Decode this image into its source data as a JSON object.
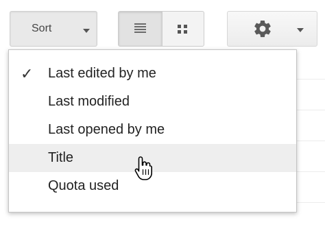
{
  "toolbar": {
    "sort_label": "Sort",
    "sort_caret_icon": "chevron-down-icon",
    "list_view_icon": "list-view-icon",
    "grid_view_icon": "grid-view-icon",
    "settings_icon": "gear-icon",
    "settings_caret_icon": "chevron-down-icon"
  },
  "sort_menu": {
    "items": [
      {
        "label": "Last edited by me",
        "checked": true
      },
      {
        "label": "Last modified",
        "checked": false
      },
      {
        "label": "Last opened by me",
        "checked": false
      },
      {
        "label": "Title",
        "checked": false,
        "hovered": true
      },
      {
        "label": "Quota used",
        "checked": false
      }
    ],
    "check_mark": "✓"
  },
  "pointer": "hand-cursor-icon",
  "colors": {
    "menu_hover": "#eeeeee",
    "text": "#222222",
    "border": "#c4c4c4"
  }
}
